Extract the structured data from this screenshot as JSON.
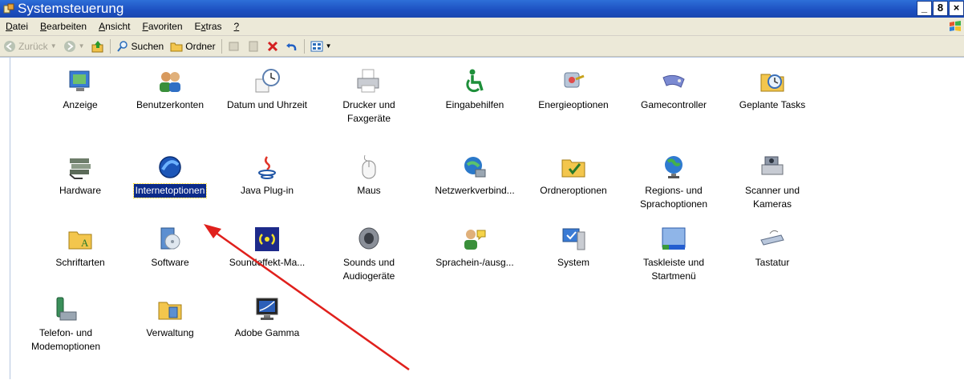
{
  "window": {
    "title": "Systemsteuerung",
    "buttons": [
      "_",
      "8",
      "×"
    ]
  },
  "menu": [
    {
      "key": "D",
      "rest": "atei"
    },
    {
      "key": "B",
      "rest": "earbeiten"
    },
    {
      "key": "A",
      "rest": "nsicht"
    },
    {
      "key": "F",
      "rest": "avoriten"
    },
    {
      "pre": "E",
      "key": "x",
      "rest": "tras"
    },
    {
      "key": "?",
      "rest": ""
    }
  ],
  "toolbar": {
    "back": "Zurück",
    "search": "Suchen",
    "folders": "Ordner"
  },
  "items": [
    {
      "label": "Anzeige",
      "icon": "display-icon"
    },
    {
      "label": "Benutzerkonten",
      "icon": "users-icon"
    },
    {
      "label": "Datum und Uhrzeit",
      "icon": "clock-icon"
    },
    {
      "label": "Drucker und\nFaxgeräte",
      "icon": "printer-icon"
    },
    {
      "label": "Eingabehilfen",
      "icon": "accessibility-icon"
    },
    {
      "label": "Energieoptionen",
      "icon": "power-icon"
    },
    {
      "label": "Gamecontroller",
      "icon": "gamepad-icon"
    },
    {
      "label": "Geplante Tasks",
      "icon": "scheduled-tasks-icon"
    },
    {
      "label": "Hardware",
      "icon": "hardware-icon"
    },
    {
      "label": "Internetoptionen",
      "icon": "internet-icon",
      "selected": true
    },
    {
      "label": "Java Plug-in",
      "icon": "java-icon"
    },
    {
      "label": "Maus",
      "icon": "mouse-icon"
    },
    {
      "label": "Netzwerkverbind...",
      "icon": "network-icon"
    },
    {
      "label": "Ordneroptionen",
      "icon": "folder-options-icon"
    },
    {
      "label": "Regions- und\nSprachoptionen",
      "icon": "globe-icon"
    },
    {
      "label": "Scanner und\nKameras",
      "icon": "scanner-icon"
    },
    {
      "label": "Schriftarten",
      "icon": "fonts-icon"
    },
    {
      "label": "Software",
      "icon": "software-icon"
    },
    {
      "label": "Soundeffekt-Ma...",
      "icon": "sound-effects-icon"
    },
    {
      "label": "Sounds und\nAudiogeräte",
      "icon": "speaker-icon"
    },
    {
      "label": "Sprachein-/ausg...",
      "icon": "speech-icon"
    },
    {
      "label": "System",
      "icon": "system-icon"
    },
    {
      "label": "Taskleiste und\nStartmenü",
      "icon": "taskbar-icon"
    },
    {
      "label": "Tastatur",
      "icon": "keyboard-icon"
    },
    {
      "label": "Telefon- und\nModemoptionen",
      "icon": "phone-icon"
    },
    {
      "label": "Verwaltung",
      "icon": "admin-tools-icon"
    },
    {
      "label": "Adobe Gamma",
      "icon": "monitor-gamma-icon"
    }
  ]
}
